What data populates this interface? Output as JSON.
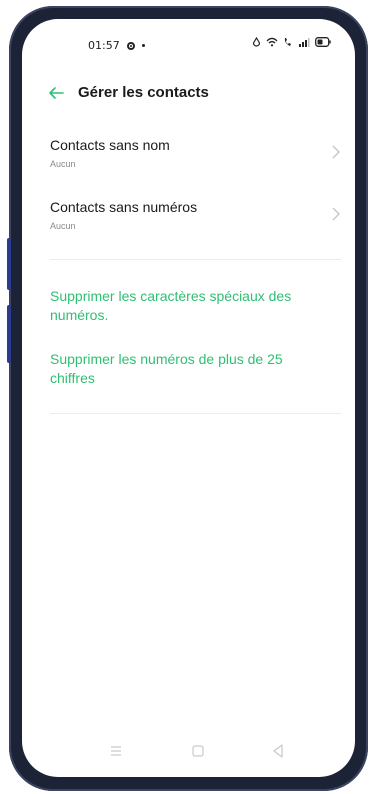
{
  "status_bar": {
    "time": "01:57",
    "left_icons": [
      "settings-icon",
      "dot-icon"
    ],
    "right_icons": [
      "data-saver-icon",
      "wifi-icon",
      "volte-icon",
      "signal-icon",
      "battery-icon"
    ]
  },
  "header": {
    "title": "Gérer les contacts"
  },
  "rows": [
    {
      "label": "Contacts sans nom",
      "value": "Aucun"
    },
    {
      "label": "Contacts sans numéros",
      "value": "Aucun"
    }
  ],
  "actions": [
    {
      "label": "Supprimer les caractères spéciaux des numéros."
    },
    {
      "label": "Supprimer les numéros de plus de 25 chiffres"
    }
  ],
  "colors": {
    "accent": "#2fbf73",
    "text": "#1a1a1a",
    "subtext": "#8a8a8a",
    "frame": "#1d2336"
  },
  "nav_bar": {
    "icons": [
      "menu-icon",
      "home-icon",
      "back-triangle-icon"
    ]
  }
}
